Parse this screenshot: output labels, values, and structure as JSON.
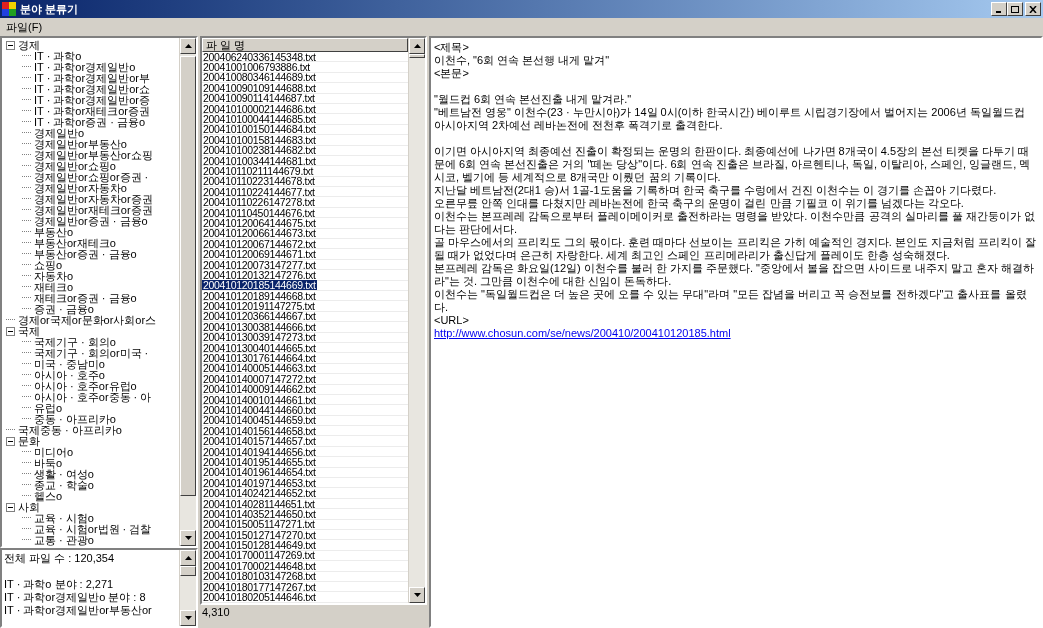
{
  "window": {
    "title": "분야 분류기"
  },
  "menu": [
    {
      "label": "파일(F)"
    }
  ],
  "tree": [
    {
      "label": "경제",
      "expanded": true,
      "children": [
        {
          "label": "IT · 과학o"
        },
        {
          "label": "IT · 과학or경제일반o"
        },
        {
          "label": "IT · 과학or경제일반or부"
        },
        {
          "label": "IT · 과학or경제일반or쇼"
        },
        {
          "label": "IT · 과학or경제일반or증"
        },
        {
          "label": "IT · 과학or재테크or증권"
        },
        {
          "label": "IT · 과학or증권 · 금융o"
        },
        {
          "label": "경제일반o"
        },
        {
          "label": "경제일반or부동산o"
        },
        {
          "label": "경제일반or부동산or쇼핑"
        },
        {
          "label": "경제일반or쇼핑o"
        },
        {
          "label": "경제일반or쇼핑or증권 ·"
        },
        {
          "label": "경제일반or자동차o"
        },
        {
          "label": "경제일반or자동차or증권"
        },
        {
          "label": "경제일반or재테크or증권"
        },
        {
          "label": "경제일반or증권 · 금융o"
        },
        {
          "label": "부동산o"
        },
        {
          "label": "부동산or재테크o"
        },
        {
          "label": "부동산or증권 · 금융o"
        },
        {
          "label": "쇼핑o"
        },
        {
          "label": "자동차o"
        },
        {
          "label": "재테크o"
        },
        {
          "label": "재테크or증권 · 금융o"
        },
        {
          "label": "증권 · 금융o"
        }
      ]
    },
    {
      "label": "경제or국제or문화or사회or스"
    },
    {
      "label": "국제",
      "expanded": true,
      "children": [
        {
          "label": "국제기구 · 회의o"
        },
        {
          "label": "국제기구 · 회의or미국 ·"
        },
        {
          "label": "미국 · 중남미o"
        },
        {
          "label": "아시아 · 호주o"
        },
        {
          "label": "아시아 · 호주or유럽o"
        },
        {
          "label": "아시아 · 호주or중동 · 아"
        },
        {
          "label": "유럽o"
        },
        {
          "label": "중동 · 아프리카o"
        }
      ]
    },
    {
      "label": "국제중동 · 아프리카o"
    },
    {
      "label": "문화",
      "expanded": true,
      "children": [
        {
          "label": "미디어o"
        },
        {
          "label": "바둑o"
        },
        {
          "label": "생활 · 여성o"
        },
        {
          "label": "종교 · 학술o"
        },
        {
          "label": "헬스o"
        }
      ]
    },
    {
      "label": "사회",
      "expanded": true,
      "children": [
        {
          "label": "교육 · 시험o"
        },
        {
          "label": "교육 · 시험or법원 · 검찰"
        },
        {
          "label": "교통 · 관광o"
        }
      ]
    }
  ],
  "stats": {
    "total": "전체 파일 수 : 120,354",
    "lines": [
      "IT · 과학o 분야 : 2,271",
      "IT · 과학or경제일반o 분야 : 8",
      "IT · 과학or경제일반or부동산or"
    ]
  },
  "file_list": {
    "header": "파 일 명",
    "count": "4,310",
    "files": [
      {
        "name": "200406240336145348.txt",
        "selected": false
      },
      {
        "name": "20041001006793886.txt",
        "selected": false
      },
      {
        "name": "200410080346144689.txt",
        "selected": false
      },
      {
        "name": "200410090109144688.txt",
        "selected": false
      },
      {
        "name": "200410090114144687.txt",
        "selected": false
      },
      {
        "name": "200410100002144686.txt",
        "selected": false
      },
      {
        "name": "200410100044144685.txt",
        "selected": false
      },
      {
        "name": "200410100150144684.txt",
        "selected": false
      },
      {
        "name": "200410100158144683.txt",
        "selected": false
      },
      {
        "name": "200410100238144682.txt",
        "selected": false
      },
      {
        "name": "200410100344144681.txt",
        "selected": false
      },
      {
        "name": "200410110211144679.txt",
        "selected": false
      },
      {
        "name": "200410110223144678.txt",
        "selected": false
      },
      {
        "name": "200410110224144677.txt",
        "selected": false
      },
      {
        "name": "200410110226147278.txt",
        "selected": false
      },
      {
        "name": "200410110450144676.txt",
        "selected": false
      },
      {
        "name": "200410120064144675.txt",
        "selected": false
      },
      {
        "name": "200410120066144673.txt",
        "selected": false
      },
      {
        "name": "200410120067144672.txt",
        "selected": false
      },
      {
        "name": "200410120069144671.txt",
        "selected": false
      },
      {
        "name": "200410120073147277.txt",
        "selected": false
      },
      {
        "name": "200410120132147276.txt",
        "selected": false
      },
      {
        "name": "200410120185144669.txt",
        "selected": true
      },
      {
        "name": "200410120189144668.txt",
        "selected": false
      },
      {
        "name": "200410120191147275.txt",
        "selected": false
      },
      {
        "name": "200410120366144667.txt",
        "selected": false
      },
      {
        "name": "200410130038144666.txt",
        "selected": false
      },
      {
        "name": "200410130039147273.txt",
        "selected": false
      },
      {
        "name": "200410130040144665.txt",
        "selected": false
      },
      {
        "name": "200410130176144664.txt",
        "selected": false
      },
      {
        "name": "200410140005144663.txt",
        "selected": false
      },
      {
        "name": "200410140007147272.txt",
        "selected": false
      },
      {
        "name": "200410140009144662.txt",
        "selected": false
      },
      {
        "name": "200410140010144661.txt",
        "selected": false
      },
      {
        "name": "200410140044144660.txt",
        "selected": false
      },
      {
        "name": "200410140045144659.txt",
        "selected": false
      },
      {
        "name": "200410140156144658.txt",
        "selected": false
      },
      {
        "name": "200410140157144657.txt",
        "selected": false
      },
      {
        "name": "200410140194144656.txt",
        "selected": false
      },
      {
        "name": "200410140195144655.txt",
        "selected": false
      },
      {
        "name": "200410140196144654.txt",
        "selected": false
      },
      {
        "name": "200410140197144653.txt",
        "selected": false
      },
      {
        "name": "200410140242144652.txt",
        "selected": false
      },
      {
        "name": "200410140281144651.txt",
        "selected": false
      },
      {
        "name": "200410140352144650.txt",
        "selected": false
      },
      {
        "name": "200410150051147271.txt",
        "selected": false
      },
      {
        "name": "200410150127147270.txt",
        "selected": false
      },
      {
        "name": "200410150128144649.txt",
        "selected": false
      },
      {
        "name": "200410170001147269.txt",
        "selected": false
      },
      {
        "name": "200410170002144648.txt",
        "selected": false
      },
      {
        "name": "200410180103147268.txt",
        "selected": false
      },
      {
        "name": "200410180177147267.txt",
        "selected": false
      },
      {
        "name": "200410180205144646.txt",
        "selected": false
      }
    ]
  },
  "article": {
    "title_tag": "<제목>",
    "title": "이천수, \"6회 연속 본선행 내게 맡겨\"",
    "body_tag": "<본문>",
    "sections": [
      [
        "\"월드컵 6회 연속 본선진출 내게 맡겨라.\"",
        "\"베트남전 영웅\" 이천수(23 · 누만시아)가 14일 0시(이하 한국시간) 베이루트 시립경기장에서 벌어지는 2006년 독일월드컵 아시아지역 2차예선 레바논전에 전천후 폭격기로 출격한다."
      ],
      [
        "이기면 아시아지역 최종예선 진출이 확정되는 운명의 한판이다. 최종예선에 나가면 8개국이 4.5장의 본선 티켓을 다투기 때문에 6회 연속 본선진출은 거의 \"떼논 당상\"이다. 6회 연속 진출은 브라질, 아르헨티나, 독일, 이탈리아, 스페인, 잉글랜드, 멕시코, 벨기에 등 세계적으로 8개국만 이뤘던 꿈의 기록이다.",
        "지난달 베트남전(2대1 승)서 1골-1도움을 기록하며 한국 축구를 수렁에서 건진 이천수는 이 경기를 손꼽아 기다렸다.",
        "오른무릎 안쪽 인대를 다쳤지만 레바논전에 한국 축구의 운명이 걸린 만큼 기필코 이 위기를 넘겠다는 각오다.",
        "이천수는 본프레레 감독으로부터 플레이메이커로 출전하라는 명령을 받았다. 이천수만큼 공격의 실마리를 풀 재간둥이가 없다는 판단에서다.",
        "골 마우스에서의 프리킥도 그의 몫이다. 훈련 때마다 선보이는 프리킥은 가히 예술적인 경지다. 본인도 지금처럼 프리킥이 잘될 때가 없었다며 은근히 자랑한다. 세계 최고인 스페인 프리메라리가 출신답게 플레이도 한층 성숙해졌다.",
        "본프레레 감독은 화요일(12일) 이천수를 불러 한 가지를 주문했다. \"중앙에서 볼을 잡으면 사이드로 내주지 말고 혼자 해결하라\"는 것. 그만큼 이천수에 대한 신임이 돈독하다.",
        "이천수는 \"독일월드컵은 더 높은 곳에 오를 수 있는 무대\"라며 \"모든 잡념을 버리고 꼭 승전보를 전하겠다\"고 출사표를 올렸다."
      ]
    ],
    "url_tag": "<URL>",
    "url": "http://www.chosun.com/se/news/200410/200410120185.html"
  }
}
